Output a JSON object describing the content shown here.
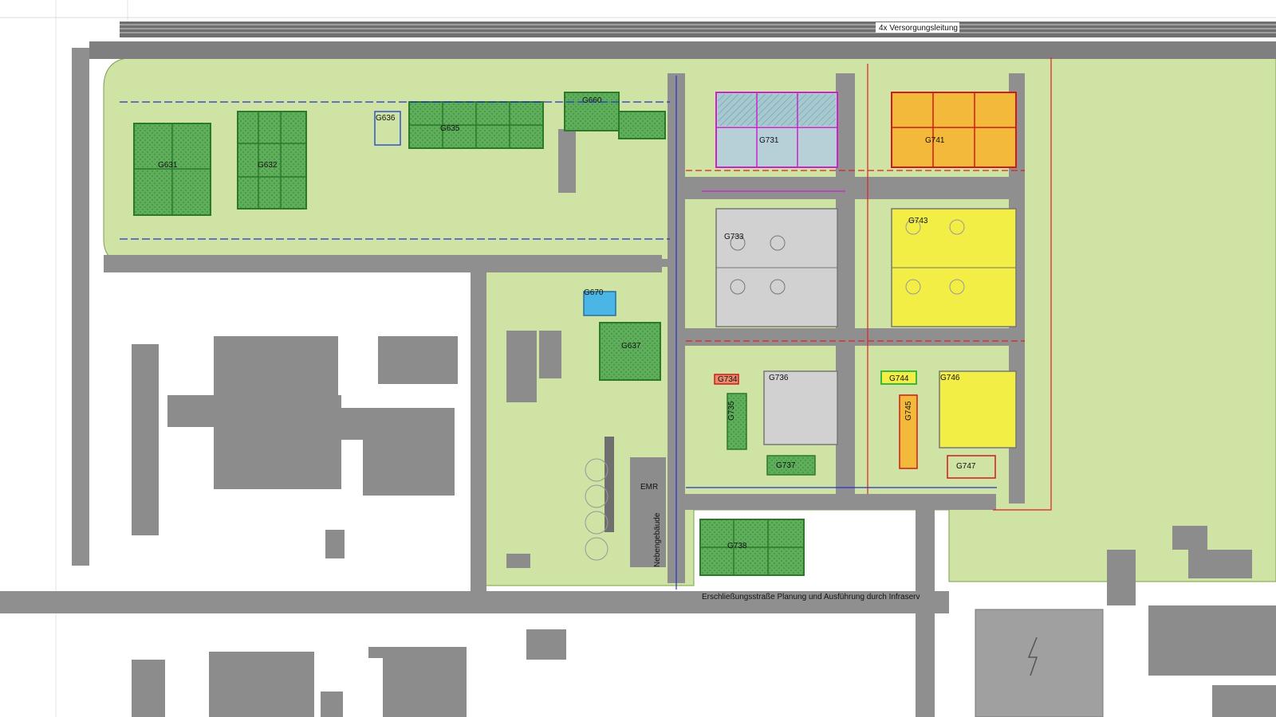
{
  "colors": {
    "building": "#8c8c8c",
    "road": "#8f8f8f",
    "lawn": "#cfe3a4",
    "green_roof": "#5fae5c",
    "yellow_field": "#f3ee45",
    "orange_field": "#f2b93a",
    "water_field": "#9fc6d2",
    "grey_field": "#cfcfcf",
    "red_line": "#e02020",
    "blue_line": "#2233cc",
    "magenta_line": "#cc22cc"
  },
  "labels": {
    "top_pipeline": "4x Versorgungsleitung",
    "bottom_road": "Erschließungsstraße Planung und Ausführung durch Infraserv",
    "emr": "EMR",
    "nebengebaeude": "Nebengebäude"
  },
  "blocks": [
    {
      "id": "G631",
      "fill": "green"
    },
    {
      "id": "G632",
      "fill": "green"
    },
    {
      "id": "G635",
      "fill": "green"
    },
    {
      "id": "G636",
      "fill": "none"
    },
    {
      "id": "G660",
      "fill": "green"
    },
    {
      "id": "G731",
      "fill": "water"
    },
    {
      "id": "G741",
      "fill": "orange"
    },
    {
      "id": "G733",
      "fill": "grey"
    },
    {
      "id": "G743",
      "fill": "yellow"
    },
    {
      "id": "G670",
      "fill": "blue"
    },
    {
      "id": "G637",
      "fill": "green"
    },
    {
      "id": "G734",
      "fill": "none"
    },
    {
      "id": "G736",
      "fill": "grey"
    },
    {
      "id": "G744",
      "fill": "none"
    },
    {
      "id": "G746",
      "fill": "yellow"
    },
    {
      "id": "G735",
      "fill": "green"
    },
    {
      "id": "G745",
      "fill": "orange"
    },
    {
      "id": "G737",
      "fill": "green"
    },
    {
      "id": "G747",
      "fill": "none"
    },
    {
      "id": "G738",
      "fill": "green"
    }
  ]
}
